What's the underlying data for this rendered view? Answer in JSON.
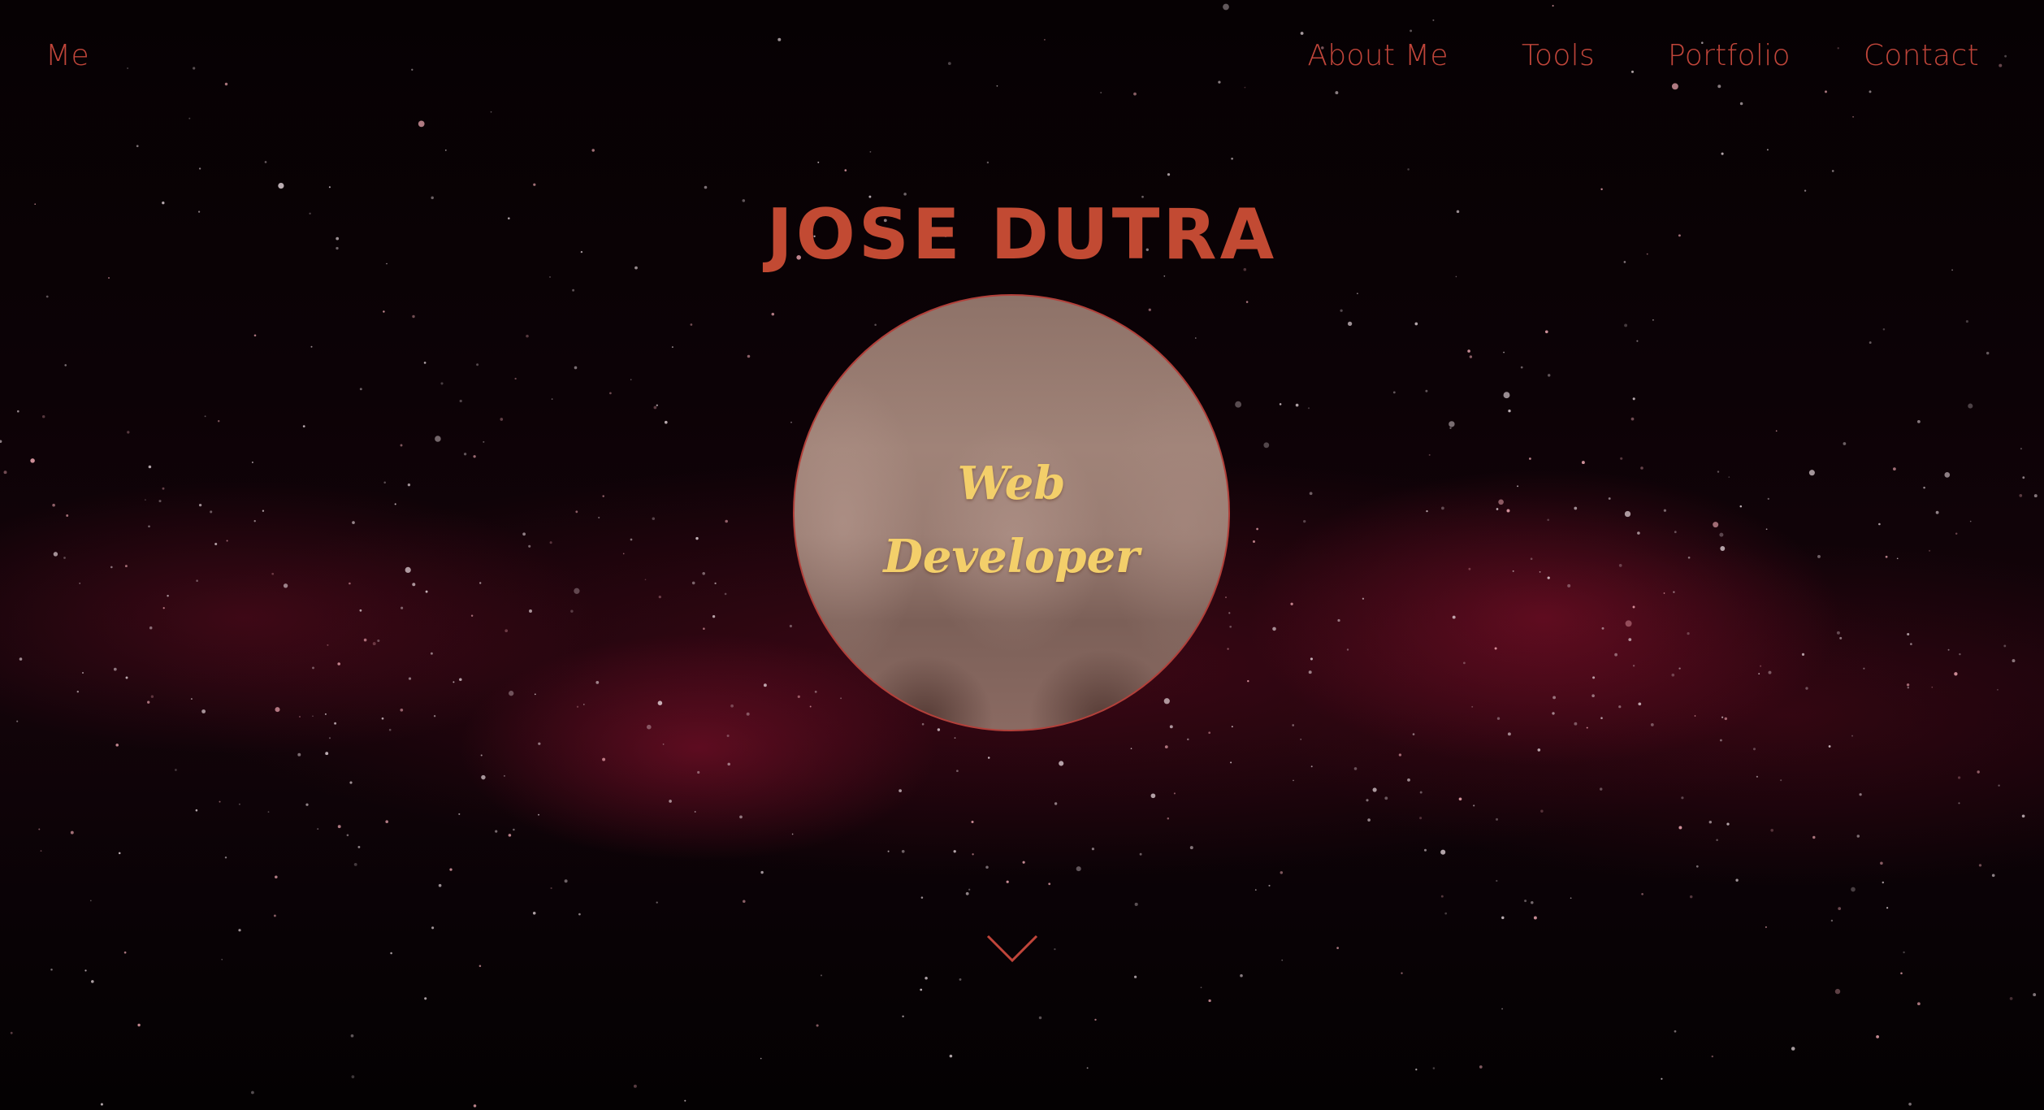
{
  "nav": {
    "brand": "Me",
    "links": [
      "About Me",
      "Tools",
      "Portfolio",
      "Contact"
    ]
  },
  "hero": {
    "title": "JOSE DUTRA",
    "role_line1": "Web",
    "role_line2": "Developer"
  },
  "icons": {
    "scroll": "chevron-down-icon"
  },
  "colors": {
    "accent": "#c0453a",
    "role_text": "#f3cf6a",
    "background": "#050103"
  }
}
